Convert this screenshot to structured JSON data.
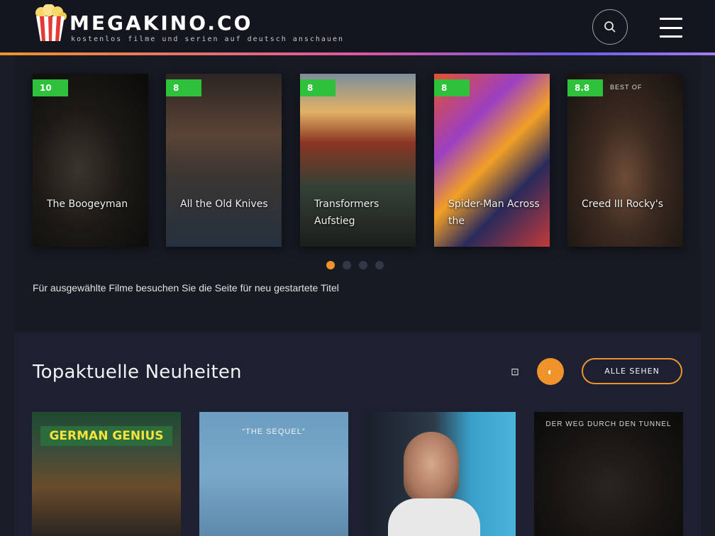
{
  "header": {
    "brand": "MEGAKINO.CO",
    "tagline": "kostenlos filme und serien auf deutsch anschauen"
  },
  "hero": {
    "posters": [
      {
        "badge": "10",
        "title": "The Boogeyman",
        "meta": ""
      },
      {
        "badge": "8",
        "title": "All the Old Knives",
        "meta": ""
      },
      {
        "badge": "8",
        "title": "Transformers Aufstieg",
        "meta": ""
      },
      {
        "badge": "8",
        "title": "Spider-Man Across the",
        "meta": ""
      },
      {
        "badge": "8.8",
        "title": "Creed III Rocky's",
        "meta": "BEST OF"
      }
    ],
    "description": "Für ausgewählte Filme besuchen Sie die Seite für neu gestartete Titel"
  },
  "section": {
    "title": "Topaktuelle Neuheiten",
    "plain_icon": "⊡",
    "active_icon": "◐",
    "button_label": "ALLE SEHEN"
  },
  "cards": [
    {
      "title": "GERMAN GENIUS"
    },
    {
      "title": "“THE SEQUEL”"
    },
    {
      "title": ""
    },
    {
      "title": "DER WEG DURCH DEN TUNNEL"
    }
  ],
  "colors": {
    "accent": "#f0932b",
    "badge": "#2ec13a",
    "background": "#1a1d27"
  }
}
